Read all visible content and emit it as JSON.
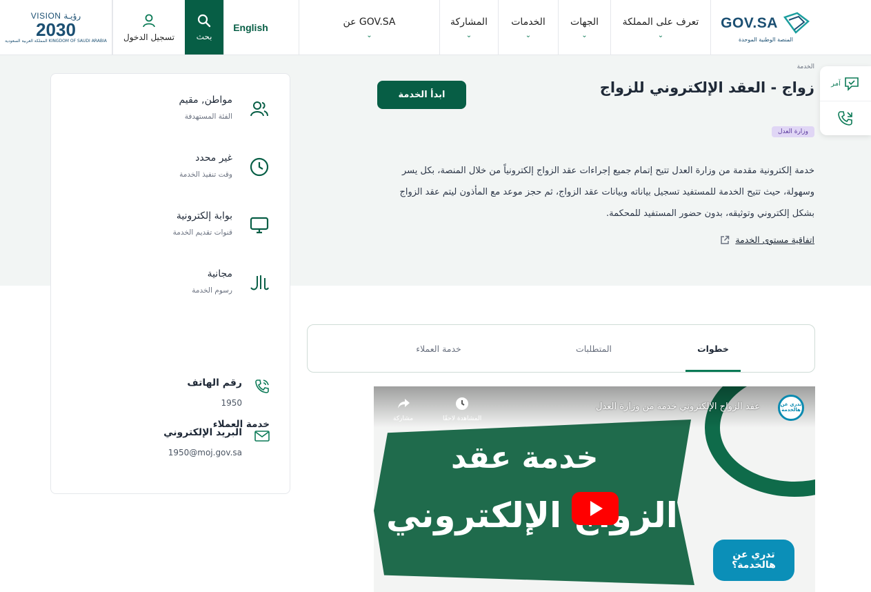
{
  "header": {
    "logo": {
      "title": "GOV.SA",
      "subtitle": "المنصة الوطنية الموحدة"
    },
    "nav": [
      {
        "label": "تعرف على المملكة"
      },
      {
        "label": "الجهات"
      },
      {
        "label": "الخدمات"
      },
      {
        "label": "المشاركة"
      },
      {
        "label": "عن GOV.SA"
      }
    ],
    "english_label": "English",
    "search_label": "بحث",
    "login_label": "تسجيل الدخول",
    "vision": {
      "top": "VISION رؤيـة",
      "year": "2030",
      "sub": "المملكة العربية السعودية KINGDOM OF SAUDI ARABIA"
    }
  },
  "breadcrumb": "الخدمة",
  "service": {
    "title": "زواج - العقد الإلكتروني للزواج",
    "start_button": "ابدأ الخدمة",
    "ministry": "وزارة العدل",
    "description": "خدمة إلكترونية مقدمة من وزارة العدل تتيح إتمام جميع إجراءات عقد الزواج إلكترونياً من خلال المنصة، بكل يسر وسهولة، حيث تتيح الخدمة للمستفيد تسجيل بياناته وبيانات عقد الزواج، ثم حجز موعد مع المأذون ليتم عقد الزواج بشكل إلكتروني وتوثيقه، بدون حضور المستفيد للمحكمة.",
    "sla_link": "اتفاقية مستوى الخدمة"
  },
  "float_panel": {
    "amer_label": "آمر"
  },
  "info": [
    {
      "value": "مواطن, مقيم",
      "label": "الفئة المستهدفة",
      "icon": "users-icon"
    },
    {
      "value": "غير محدد",
      "label": "وقت تنفيذ الخدمة",
      "icon": "clock-icon"
    },
    {
      "value": "بوابة إلكترونية",
      "label": "قنوات تقديم الخدمة",
      "icon": "monitor-icon"
    },
    {
      "value": "مجانية",
      "label": "رسوم الخدمة",
      "icon": "riyal-icon"
    }
  ],
  "customer_service": {
    "title": "خدمة العملاء",
    "phone_label": "رقم الهاتف",
    "phone_value": "1950",
    "email_label": "البريد الإلكتروني",
    "email_value": "1950@moj.gov.sa"
  },
  "tabs": [
    {
      "label": "خطوات",
      "active": true
    },
    {
      "label": "المتطلبات",
      "active": false
    },
    {
      "label": "خدمة العملاء",
      "active": false
    }
  ],
  "video": {
    "title": "عقد الزواج الإلكتروني خدمة من وزارة العدل",
    "share_label": "مشاركة",
    "watch_later_label": "المشاهدة لاحقًا",
    "line1": "خدمة عقد",
    "line2": "الزواج الإلكتروني",
    "bubble": "تدري عن هالخدمة؟",
    "channel_logo": "تدري عن هالخدمة"
  },
  "colors": {
    "primary": "#075e45",
    "accent": "#0b7a56",
    "badge_bg": "#e0d6f5"
  }
}
